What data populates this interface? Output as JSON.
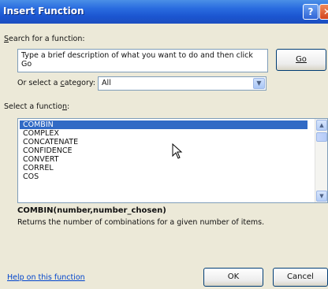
{
  "window": {
    "title": "Insert Function",
    "help_glyph": "?",
    "close_glyph": "✕"
  },
  "search": {
    "label_pre": "",
    "label_u": "S",
    "label_post": "earch for a function:",
    "description_text": "Type a brief description of what you want to do and then click Go",
    "go_button": "Go"
  },
  "category": {
    "label_pre": "Or select a ",
    "label_u": "c",
    "label_post": "ategory:",
    "selected": "All",
    "dropdown_glyph": "▼"
  },
  "functions": {
    "label_pre": "Select a functio",
    "label_u": "n",
    "label_post": ":",
    "items": [
      "COMBIN",
      "COMPLEX",
      "CONCATENATE",
      "CONFIDENCE",
      "CONVERT",
      "CORREL",
      "COS"
    ],
    "selected_index": 0,
    "scroll_up_glyph": "▲",
    "scroll_down_glyph": "▼"
  },
  "details": {
    "signature": "COMBIN(number,number_chosen)",
    "description": "Returns the number of combinations for a given number of items."
  },
  "footer": {
    "help_link": "Help on this function",
    "ok_button": "OK",
    "cancel_button": "Cancel"
  },
  "colors": {
    "titlebar": "#2a6ce0",
    "selection": "#316ac5",
    "dialog_bg": "#ece9d8",
    "link": "#0044cc"
  }
}
